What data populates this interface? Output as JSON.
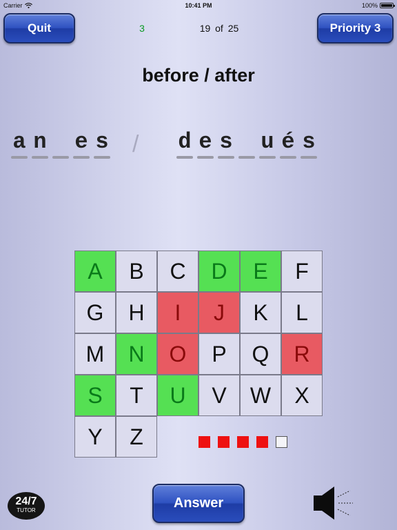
{
  "status_bar": {
    "carrier": "Carrier",
    "time": "10:41 PM",
    "battery": "100%",
    "battery_level": 1.0
  },
  "header": {
    "quit_label": "Quit",
    "score": "3",
    "progress_text": "19 of 25",
    "priority_label": "Priority 3"
  },
  "title": "before / after",
  "puzzle": {
    "separator": "/",
    "before_letters": [
      "a",
      "n",
      "",
      "e",
      "s"
    ],
    "after_letters": [
      "d",
      "e",
      "s",
      "",
      "u",
      "é",
      "s"
    ]
  },
  "letters": [
    {
      "letter": "A",
      "state": "correct"
    },
    {
      "letter": "B",
      "state": "unused"
    },
    {
      "letter": "C",
      "state": "unused"
    },
    {
      "letter": "D",
      "state": "correct"
    },
    {
      "letter": "E",
      "state": "correct"
    },
    {
      "letter": "F",
      "state": "unused"
    },
    {
      "letter": "G",
      "state": "unused"
    },
    {
      "letter": "H",
      "state": "unused"
    },
    {
      "letter": "I",
      "state": "wrong"
    },
    {
      "letter": "J",
      "state": "wrong"
    },
    {
      "letter": "K",
      "state": "unused"
    },
    {
      "letter": "L",
      "state": "unused"
    },
    {
      "letter": "M",
      "state": "unused"
    },
    {
      "letter": "N",
      "state": "correct"
    },
    {
      "letter": "O",
      "state": "wrong"
    },
    {
      "letter": "P",
      "state": "unused"
    },
    {
      "letter": "Q",
      "state": "unused"
    },
    {
      "letter": "R",
      "state": "wrong"
    },
    {
      "letter": "S",
      "state": "correct"
    },
    {
      "letter": "T",
      "state": "unused"
    },
    {
      "letter": "U",
      "state": "correct"
    },
    {
      "letter": "V",
      "state": "unused"
    },
    {
      "letter": "W",
      "state": "unused"
    },
    {
      "letter": "X",
      "state": "unused"
    },
    {
      "letter": "Y",
      "state": "unused"
    },
    {
      "letter": "Z",
      "state": "unused"
    }
  ],
  "wrong_guesses": {
    "used": 4,
    "total": 5
  },
  "answer_label": "Answer",
  "logo": {
    "line1": "24/7",
    "line2": "TUTOR"
  },
  "icons": {
    "speaker": "speaker-icon",
    "wifi": "wifi-icon"
  },
  "colors": {
    "correct": "#55e053",
    "wrong": "#e85a62",
    "unused": "#dcdcee",
    "try_marker": "#ee1111",
    "score": "#0a9a22"
  }
}
